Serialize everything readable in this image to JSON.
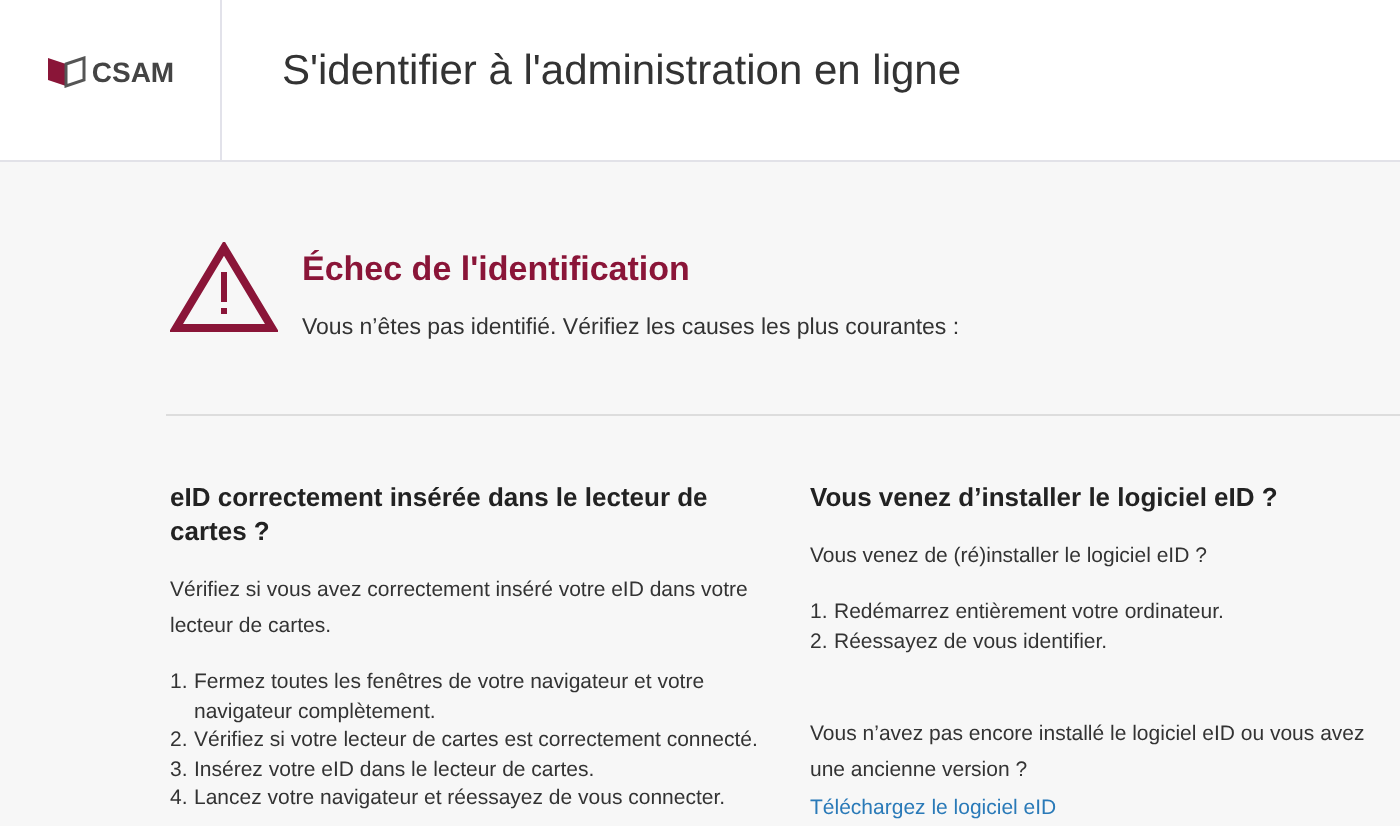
{
  "header": {
    "logo_text": "CSAM",
    "title": "S'identifier à l'administration en ligne"
  },
  "alert": {
    "title": "Échec de l'identification",
    "message": "Vous n’êtes pas identifié. Vérifiez les causes les plus courantes :"
  },
  "sections": [
    {
      "heading": "eID correctement insérée dans le lecteur de cartes ?",
      "intro": "Vérifiez si vous avez correctement inséré votre eID dans votre lecteur de cartes.",
      "steps": [
        {
          "number": "1.",
          "text": "Fermez toutes les fenêtres de votre navigateur et votre navigateur complètement."
        },
        {
          "number": "2.",
          "text": "Vérifiez si votre lecteur de cartes est correctement connecté."
        },
        {
          "number": "3.",
          "text": "Insérez votre eID dans le lecteur de cartes."
        },
        {
          "number": "4.",
          "text": "Lancez votre navigateur et réessayez de vous connecter."
        }
      ]
    },
    {
      "heading": "Vous venez d’installer le logiciel eID ?",
      "intro": "Vous venez de (ré)installer le logiciel eID ?",
      "steps": [
        {
          "number": "1.",
          "text": "Redémarrez entièrement votre ordinateur."
        },
        {
          "number": "2.",
          "text": "Réessayez de vous identifier."
        }
      ],
      "note": "Vous n’avez pas encore installé le logiciel eID ou vous avez une ancienne version ?",
      "link": "Téléchargez le logiciel eID"
    }
  ]
}
